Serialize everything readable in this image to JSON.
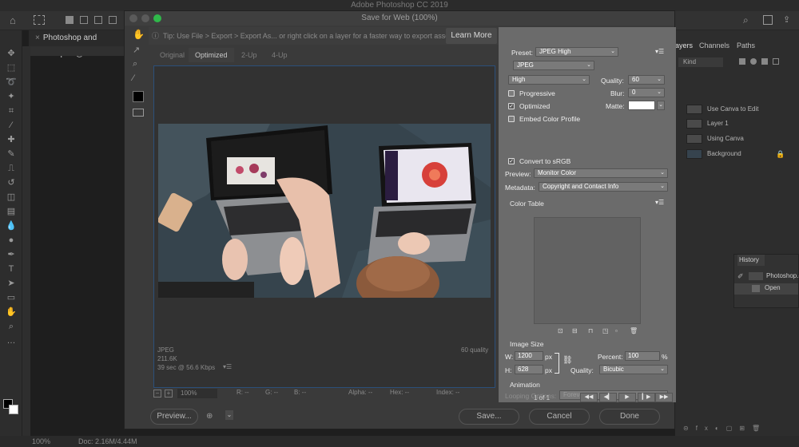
{
  "app": {
    "title": "Adobe Photoshop CC 2019",
    "document_tab": "Photoshop and Canva.psd @",
    "statusbar": {
      "zoom": "100%",
      "doc": "Doc: 2.16M/4.44M"
    }
  },
  "dialog": {
    "title": "Save for Web (100%)",
    "tip": "Tip: Use File > Export > Export As... or right click on a layer for a faster way to export assets",
    "learn_more": "Learn More",
    "tabs": [
      "Original",
      "Optimized",
      "2-Up",
      "4-Up"
    ],
    "preview_info": {
      "format": "JPEG",
      "size": "211.6K",
      "time": "39 sec @ 56.6 Kbps",
      "quality": "60 quality"
    },
    "zoom_bar": {
      "zoom": "100%",
      "r": "R: --",
      "g": "G: --",
      "b": "B: --",
      "alpha": "Alpha: --",
      "hex": "Hex: --",
      "index": "Index: --"
    },
    "settings": {
      "preset_label": "Preset:",
      "preset_value": "JPEG High",
      "format": "JPEG",
      "compression": "High",
      "quality_label": "Quality:",
      "quality_value": "60",
      "blur_label": "Blur:",
      "blur_value": "0",
      "matte_label": "Matte:",
      "progressive": "Progressive",
      "optimized": "Optimized",
      "embed_profile": "Embed Color Profile",
      "convert_srgb": "Convert to sRGB",
      "preview_label": "Preview:",
      "preview_value": "Monitor Color",
      "metadata_label": "Metadata:",
      "metadata_value": "Copyright and Contact Info",
      "color_table": "Color Table",
      "image_size": "Image Size",
      "w_label": "W:",
      "w_value": "1200",
      "h_label": "H:",
      "h_value": "628",
      "px": "px",
      "percent_label": "Percent:",
      "percent_value": "100",
      "percent_unit": "%",
      "quality2_label": "Quality:",
      "quality2_value": "Bicubic",
      "animation": "Animation",
      "looping_label": "Looping Options:",
      "looping_value": "Forever",
      "frame_counter": "1 of 1"
    },
    "buttons": {
      "preview": "Preview...",
      "save": "Save...",
      "cancel": "Cancel",
      "done": "Done"
    }
  },
  "dock": {
    "tabs": [
      "ayers",
      "Channels",
      "Paths"
    ],
    "kind": "Kind",
    "layers": [
      "Use Canva to Edit",
      "Layer 1",
      "Using Canva",
      "Background"
    ],
    "history_title": "History",
    "history_items": [
      "Photoshop.c",
      "Open"
    ]
  },
  "colors": {
    "accent_blue": "#2b4f7a",
    "panel_gray": "#6b6b6b",
    "dialog_bg": "#3a3a3a"
  }
}
